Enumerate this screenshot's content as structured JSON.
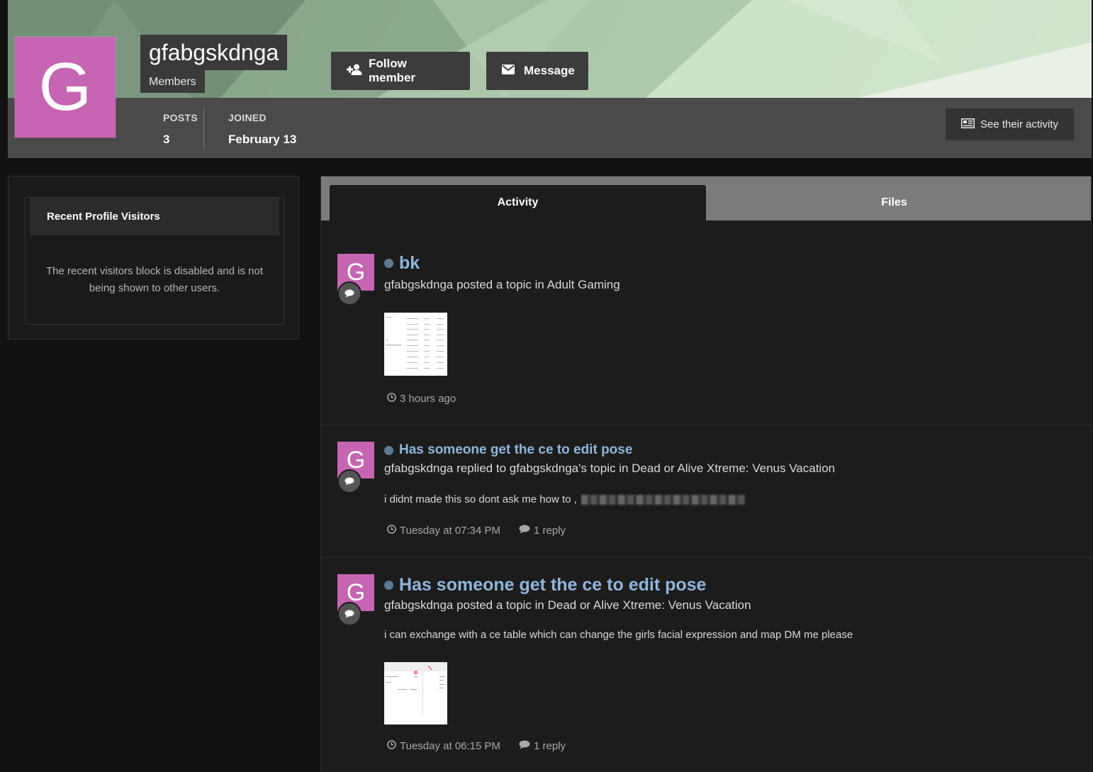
{
  "profile": {
    "avatar_letter": "G",
    "username": "gfabgskdnga",
    "group": "Members",
    "follow_label": "Follow member",
    "message_label": "Message",
    "stats": [
      {
        "label": "POSTS",
        "value": "3"
      },
      {
        "label": "JOINED",
        "value": "February 13"
      }
    ],
    "activity_button_label": "See their activity",
    "colors": {
      "avatar": "#c665b2",
      "link": "#8fb5dc"
    }
  },
  "sidebar": {
    "widget_title": "Recent Profile Visitors",
    "widget_text": "The recent visitors block is disabled and is not being shown to other users."
  },
  "tabs": [
    {
      "label": "Activity",
      "active": true
    },
    {
      "label": "Files",
      "active": false
    }
  ],
  "activity": [
    {
      "avatar_letter": "G",
      "title": "bk",
      "meta": "gfabgskdnga posted a topic in Adult Gaming",
      "time": "3 hours ago"
    },
    {
      "avatar_letter": "G",
      "title": "Has someone get the ce to edit pose",
      "meta": "gfabgskdnga replied to gfabgskdnga's topic in Dead or Alive Xtreme: Venus Vacation",
      "snippet": "i didnt made this so dont ask me how to ,",
      "time": "Tuesday at 07:34 PM",
      "replies": "1 reply"
    },
    {
      "avatar_letter": "G",
      "title": "Has someone get the ce to edit pose",
      "meta": "gfabgskdnga posted a topic in Dead or Alive Xtreme: Venus Vacation",
      "snippet": "i can exchange with a ce table which can change the girls facial expression and map DM me please",
      "time": "Tuesday at 06:15 PM",
      "replies": "1 reply"
    }
  ]
}
